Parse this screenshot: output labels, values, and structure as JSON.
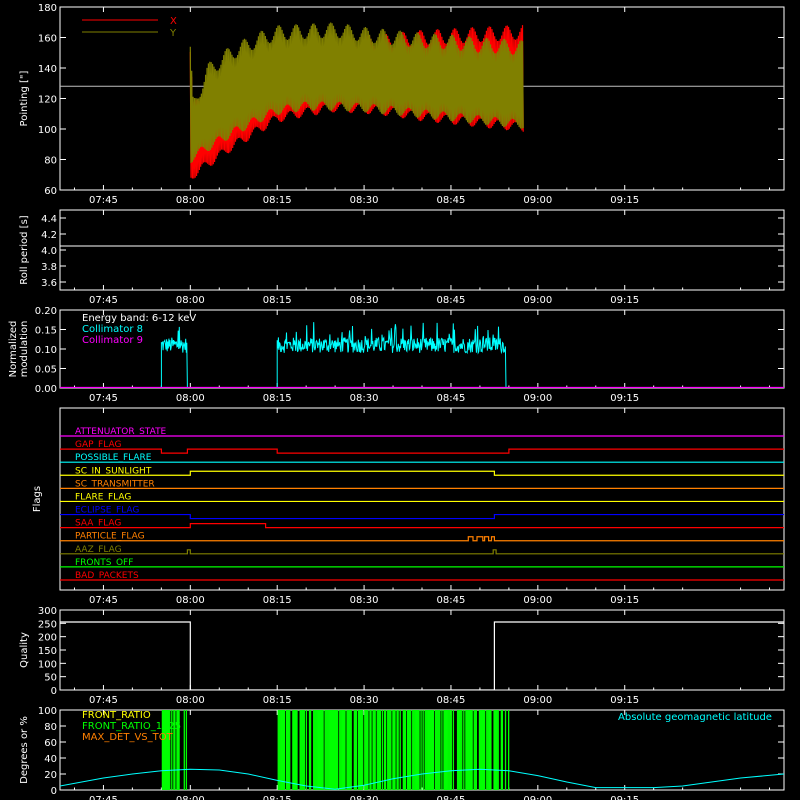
{
  "chart_data": {
    "type": "multi-panel",
    "x_axis": {
      "ticks": [
        "07:45",
        "08:00",
        "08:15",
        "08:30",
        "08:45",
        "09:00",
        "09:15"
      ],
      "range_minutes": [
        -37.5,
        87.5
      ],
      "tick_minutes": [
        -30,
        -15,
        0,
        15,
        30,
        45,
        60
      ]
    },
    "panels": [
      {
        "id": "pointing",
        "type": "line",
        "ylabel": "Pointing [\"]",
        "ylim": [
          60,
          180
        ],
        "yticks": [
          60,
          80,
          100,
          120,
          140,
          160,
          180
        ],
        "reference_line": 128,
        "series": [
          {
            "name": "X",
            "color": "#ff0000",
            "x": [
              -15,
              -14.5,
              -12,
              -8,
              -3,
              0,
              5,
              10,
              15,
              20,
              25,
              30,
              35,
              40,
              42.5
            ],
            "upper": [
              151,
              112,
              126,
              136,
              142,
              147,
              150,
              152,
              156,
              158,
              160,
              161,
              162,
              163,
              164
            ],
            "lower": [
              68,
              70,
              77,
              88,
              100,
              107,
              111,
              114,
              113,
              111,
              108,
              106,
              104,
              102,
              101
            ]
          },
          {
            "name": "Y",
            "color": "#808000",
            "x": [
              -15,
              -14.5,
              -12,
              -8,
              -3,
              0,
              5,
              10,
              15,
              20,
              25,
              30,
              35,
              40,
              42.5
            ],
            "upper": [
              150,
              115,
              138,
              150,
              159,
              163,
              164,
              165,
              162,
              160,
              158,
              157,
              155,
              154,
              153
            ],
            "lower": [
              80,
              82,
              88,
              97,
              107,
              112,
              115,
              115,
              114,
              112,
              110,
              108,
              106,
              104,
              103
            ]
          }
        ]
      },
      {
        "id": "roll",
        "type": "line",
        "ylabel": "Roll period [s]",
        "ylim": [
          3.5,
          4.5
        ],
        "yticks": [
          3.6,
          3.8,
          4.0,
          4.2,
          4.4
        ],
        "series": [
          {
            "name": "",
            "color": "#ffffff",
            "x": [
              -37.5,
              87.5
            ],
            "y": [
              4.05,
              4.05
            ]
          }
        ]
      },
      {
        "id": "modulation",
        "type": "line",
        "ylabel": "Normalized modulation",
        "ylim": [
          0,
          0.2
        ],
        "yticks": [
          0.0,
          0.05,
          0.1,
          0.15,
          0.2
        ],
        "legend": [
          "Energy band: 6-12 keV",
          "Collimator 8",
          "Collimator 9"
        ],
        "legend_colors": [
          "#ffffff",
          "#00ffff",
          "#ff00ff"
        ],
        "series": [
          {
            "name": "Collimator 8",
            "color": "#00ffff",
            "segments": [
              [
                -20,
                -15.5
              ],
              [
                0,
                39.5
              ]
            ],
            "level": 0.11,
            "noise": 0.02
          },
          {
            "name": "Collimator 9",
            "color": "#ff00ff",
            "segments": [
              [
                -37.5,
                87.5
              ]
            ],
            "level": 0.0,
            "noise": 0
          }
        ]
      },
      {
        "id": "flags",
        "type": "step",
        "ylabel": "Flags",
        "flags": [
          {
            "name": "ATTENUATOR_STATE",
            "color": "#ff00ff",
            "transitions": []
          },
          {
            "name": "GAP_FLAG",
            "color": "#ff0000",
            "transitions": [
              [
                -20,
                -1
              ],
              [
                -15.5,
                1
              ],
              [
                0,
                -1
              ],
              [
                40,
                1
              ]
            ]
          },
          {
            "name": "POSSIBLE_FLARE",
            "color": "#00ffff",
            "transitions": []
          },
          {
            "name": "SC_IN_SUNLIGHT",
            "color": "#ffff00",
            "transitions": [
              [
                -15,
                1
              ],
              [
                37.5,
                -1
              ]
            ]
          },
          {
            "name": "SC_TRANSMITTER",
            "color": "#ff8000",
            "transitions": []
          },
          {
            "name": "FLARE_FLAG",
            "color": "#ffff00",
            "transitions": []
          },
          {
            "name": "ECLIPSE_FLAG",
            "color": "#0000ff",
            "transitions": [
              [
                -15,
                -1
              ],
              [
                37.5,
                1
              ]
            ]
          },
          {
            "name": "SAA_FLAG",
            "color": "#ff0000",
            "transitions": [
              [
                -15,
                1
              ],
              [
                -2,
                -1
              ]
            ]
          },
          {
            "name": "PARTICLE_FLAG",
            "color": "#ff8000",
            "transitions": [
              [
                33,
                1
              ],
              [
                33.8,
                -1
              ],
              [
                34.5,
                1
              ],
              [
                35.5,
                -1
              ],
              [
                35.8,
                1
              ],
              [
                36.5,
                -1
              ],
              [
                37,
                1
              ],
              [
                37.5,
                -1
              ]
            ]
          },
          {
            "name": "AAZ_FLAG",
            "color": "#808000",
            "transitions": [
              [
                -15.5,
                1
              ],
              [
                -15,
                -1
              ],
              [
                37.3,
                1
              ],
              [
                37.8,
                -1
              ]
            ]
          },
          {
            "name": "FRONTS_OFF",
            "color": "#00ff00",
            "transitions": []
          },
          {
            "name": "BAD_PACKETS",
            "color": "#ff0000",
            "transitions": []
          }
        ]
      },
      {
        "id": "quality",
        "type": "step",
        "ylabel": "Quality",
        "ylim": [
          0,
          300
        ],
        "yticks": [
          0,
          50,
          100,
          150,
          200,
          250,
          300
        ],
        "series": [
          {
            "name": "",
            "color": "#ffffff",
            "x": [
              -37.5,
              -15,
              -15,
              37.5,
              37.5,
              87.5
            ],
            "y": [
              255,
              255,
              0,
              0,
              255,
              255
            ]
          }
        ]
      },
      {
        "id": "degrees",
        "type": "bar",
        "ylabel": "Degrees or %",
        "ylim": [
          0,
          100
        ],
        "yticks": [
          0,
          20,
          40,
          60,
          80,
          100
        ],
        "legend": [
          "FRONT_RATIO",
          "FRONT_RATIO_1225",
          "MAX_DET_VS_TOT",
          "Absolute geomagnetic latitude"
        ],
        "legend_colors": [
          "#ffff00",
          "#00ff00",
          "#ff8000",
          "#00ffff"
        ],
        "bar_segments": [
          [
            -20,
            -15.5
          ],
          [
            0,
            40
          ]
        ],
        "latitude_curve": {
          "color": "#00ffff",
          "x": [
            -37.5,
            -30,
            -25,
            -20,
            -15,
            -10,
            -5,
            0,
            5,
            10,
            15,
            20,
            25,
            30,
            35,
            40,
            45,
            50,
            55,
            60,
            65,
            70,
            75,
            80,
            87.5
          ],
          "y": [
            5,
            15,
            20,
            24,
            26,
            25,
            20,
            12,
            5,
            1,
            6,
            14,
            20,
            24,
            26,
            24,
            18,
            10,
            3,
            3,
            3,
            5,
            10,
            15,
            20
          ]
        }
      }
    ]
  }
}
